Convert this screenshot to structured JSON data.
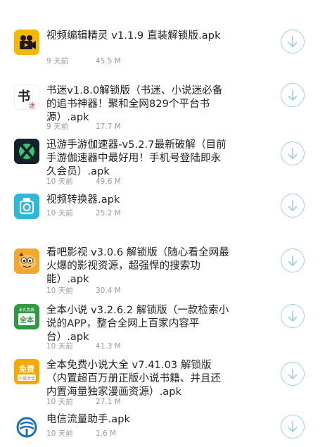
{
  "items": [
    {
      "title": "视频编辑精灵 v1.1.9 直装解锁版.apk",
      "date": "9 天前",
      "size": "45.5 M",
      "icon": "video-editor-icon",
      "color": "#f5b800"
    },
    {
      "title": "书迷v1.8.0解锁版（书迷、小说迷必备的追书神器！聚和全网829个平台书源）.apk",
      "date": "9 天前",
      "size": "17.7 M",
      "icon": "shumi-book-icon",
      "color": "#ffffff"
    },
    {
      "title": "迅游手游伽速器-v5.2.7最新破解（目前手游伽速器中最好用！手机号登陆即永久会员）.apk",
      "date": "10 天前",
      "size": "49.6 M",
      "icon": "xunyou-icon",
      "color": "#14222c"
    },
    {
      "title": "视频转换器.apk",
      "date": "10 天前",
      "size": "25.2 M",
      "icon": "video-converter-icon",
      "color": "#2fb7d8"
    },
    {
      "title": "看吧影视 v3.0.6 解锁版（随心看全网最火爆的影视资源，超强悍的搜索功能）.apk",
      "date": "10 天前",
      "size": "30.4 M",
      "icon": "kanba-icon",
      "color": "#f0a830"
    },
    {
      "title": "全本小说 v3.2.6.2 解锁版（一款检索小说的APP，整合全网上百家内容平台）.apk",
      "date": "10 天前",
      "size": "41.3 M",
      "icon": "quanben-novel-icon",
      "color": "#2f9a43"
    },
    {
      "title": "全本免费小说大全 v7.41.03 解锁版（内置超百万册正版小说书籍、并且还内置海量独家漫画资源）.apk",
      "date": "10 天前",
      "size": "27.1 M",
      "icon": "free-novel-icon",
      "color": "#f5a800"
    },
    {
      "title": "电信流量助手.apk",
      "date": "10 天前",
      "size": "1.6 M",
      "icon": "telecom-icon",
      "color": "#1a6fb8"
    }
  ],
  "icon_glyphs": {
    "shumi": "书",
    "shumi_sub": "迷",
    "quanben": "全本",
    "quanben_top": "永久免费",
    "free_main": "免费",
    "free_sub": "小说大全"
  },
  "download_icon": "download-arrow-icon",
  "accent": "#9fd0ec"
}
